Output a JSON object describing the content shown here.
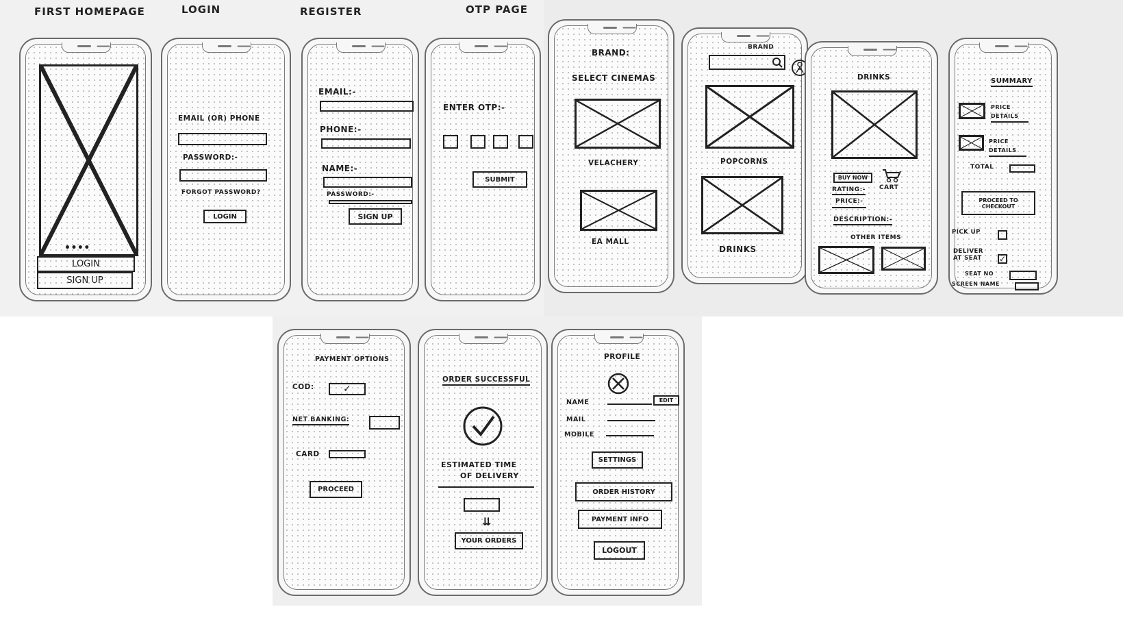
{
  "screens": {
    "first_homepage": {
      "title": "First Homepage",
      "login": "Login",
      "signup": "Sign Up",
      "dots": "••••"
    },
    "login": {
      "title": "Login",
      "email_label": "Email (or) Phone",
      "password_label": "Password:-",
      "forgot": "Forgot Password?",
      "login_button": "Login"
    },
    "register": {
      "title": "Register",
      "email_label": "Email:-",
      "phone_label": "Phone:-",
      "name_label": "Name:-",
      "password_label": "Password:-",
      "signup_button": "Sign Up"
    },
    "otp": {
      "title": "OTP Page",
      "label": "Enter OTP:-",
      "submit_button": "Submit"
    },
    "cinemas": {
      "brand": "Brand:",
      "heading": "Select Cinemas",
      "cinema_1": "Velachery",
      "cinema_2": "EA Mall"
    },
    "menu": {
      "brand": "Brand",
      "item_1": "Popcorns",
      "item_2": "Drinks"
    },
    "product": {
      "heading": "Drinks",
      "buy_now": "Buy Now",
      "cart": "Cart",
      "rating": "Rating:-",
      "price": "Price:-",
      "description": "Description:-",
      "other_items": "Other Items"
    },
    "summary": {
      "heading": "Summary",
      "price_details_1": "Price Details",
      "price_details_2": "Price Details",
      "total": "Total",
      "checkout_button": "Proceed to Checkout",
      "pickup": "Pick Up",
      "deliver": "Deliver at Seat",
      "seat_no": "Seat No",
      "screen_name": "Screen Name"
    },
    "payment": {
      "heading": "Payment Options",
      "cod": "COD:",
      "net_banking": "Net Banking:",
      "card": "Card",
      "proceed_button": "Proceed"
    },
    "order_success": {
      "heading": "Order Successful",
      "eta_line1": "Estimated Time",
      "eta_line2": "of Delivery",
      "arrow": "⇊",
      "orders_button": "Your Orders"
    },
    "profile": {
      "heading": "Profile",
      "name": "Name",
      "edit": "Edit",
      "mail": "Mail",
      "mobile": "Mobile",
      "settings": "Settings",
      "order_history": "Order History",
      "payment_info": "Payment Info",
      "logout": "Logout"
    }
  },
  "checkmarks": {
    "checked": "✓"
  }
}
